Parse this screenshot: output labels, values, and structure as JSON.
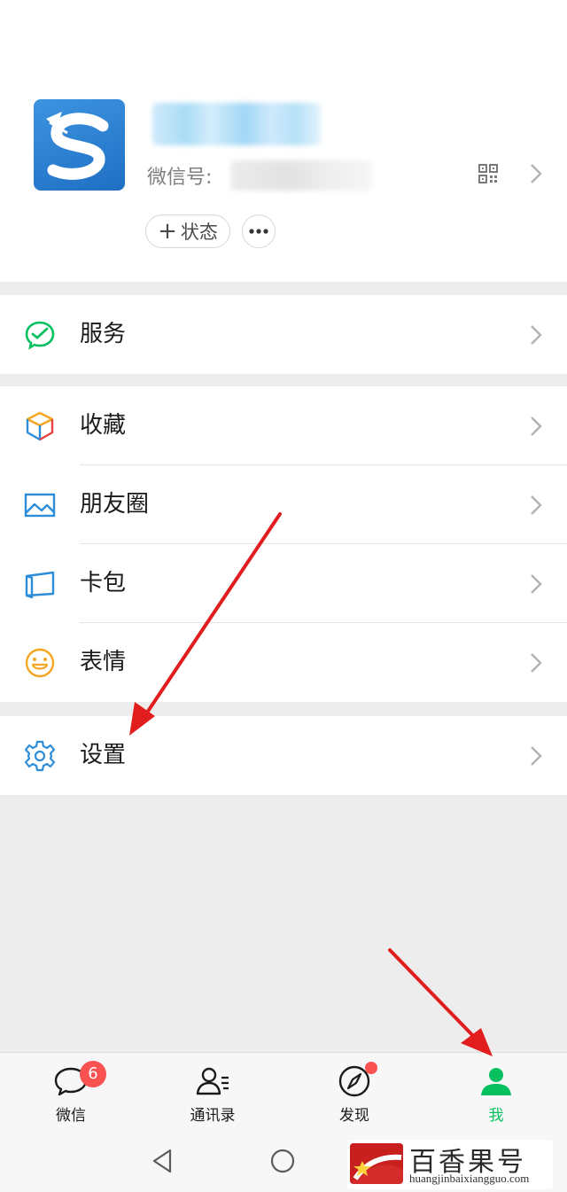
{
  "profile": {
    "wechat_id_label": "微信号:",
    "status_button_plus": "+",
    "status_button_label": "状态",
    "icons": [
      "app-logo-avatar",
      "qr-code-icon",
      "chevron-right-icon",
      "more-icon"
    ]
  },
  "menu": {
    "services": {
      "label": "服务",
      "icon": "wechat-pay-icon",
      "color": "#07c160"
    },
    "favorites": {
      "label": "收藏",
      "icon": "cube-icon"
    },
    "moments": {
      "label": "朋友圈",
      "icon": "photo-icon",
      "color": "#2e8dd9"
    },
    "cards": {
      "label": "卡包",
      "icon": "card-wallet-icon",
      "color": "#2e8dd9"
    },
    "stickers": {
      "label": "表情",
      "icon": "smiley-icon",
      "color": "#f4a623"
    },
    "settings": {
      "label": "设置",
      "icon": "gear-icon",
      "color": "#2e8dd9"
    }
  },
  "tabbar": {
    "chats": {
      "label": "微信",
      "badge": "6",
      "icon": "chat-bubble-icon"
    },
    "contacts": {
      "label": "通讯录",
      "icon": "contacts-icon"
    },
    "discover": {
      "label": "发现",
      "icon": "compass-icon"
    },
    "me": {
      "label": "我",
      "icon": "person-icon",
      "color": "#07c160"
    }
  },
  "system_nav": {
    "icons": [
      "back-triangle-icon",
      "home-circle-icon"
    ]
  },
  "watermark": {
    "title": "百香果号",
    "url": "huangjinbaixiangguo.com"
  },
  "annotation": {
    "arrow_color": "#e11d1d"
  }
}
